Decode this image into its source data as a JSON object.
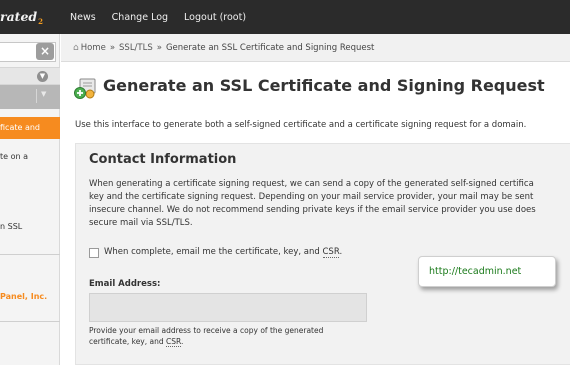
{
  "brand": {
    "logo_text": "rated",
    "logo_suffix": "2"
  },
  "topnav": {
    "items": [
      "News",
      "Change Log",
      "Logout (root)"
    ]
  },
  "sidebar": {
    "clear_icon": "x-icon",
    "items": [
      {
        "line1": "ficate and",
        "line2": "",
        "active": true
      },
      {
        "line1": "te on a",
        "line2": "",
        "active": false
      },
      {
        "line1": "n SSL",
        "line2": "",
        "active": false
      }
    ],
    "footer": "Panel, Inc."
  },
  "breadcrumb": {
    "home": "Home",
    "section": "SSL/TLS",
    "current": "Generate an SSL Certificate and Signing Request",
    "separator": "»"
  },
  "page": {
    "title": "Generate an SSL Certificate and Signing Request",
    "description": "Use this interface to generate both a self-signed certificate and a certificate signing request for a domain."
  },
  "contact": {
    "title": "Contact Information",
    "text_lines": [
      "When generating a certificate signing request, we can send a copy of the generated self-signed certifica",
      "key and the certificate signing request. Depending on your mail service provider, your mail may be sent",
      "insecure channel. We do not recommend sending private keys if the email service provider you use does",
      "secure mail via SSL/TLS."
    ],
    "checkbox_label_pre": "When complete, email me the certificate, key, and ",
    "checkbox_label_abbr": "CSR",
    "checkbox_label_post": ".",
    "checkbox_checked": false,
    "email_label": "Email Address:",
    "email_value": "",
    "help_line1": "Provide your email address to receive a copy of the generated",
    "help_line2_pre": "certificate, key, and ",
    "help_line2_abbr": "CSR",
    "help_line2_post": "."
  },
  "callout": {
    "text": "http://tecadmin.net"
  },
  "colors": {
    "accent": "#f68b1f",
    "topbar": "#2b2b2b",
    "callout_text": "#1a7a1a"
  }
}
